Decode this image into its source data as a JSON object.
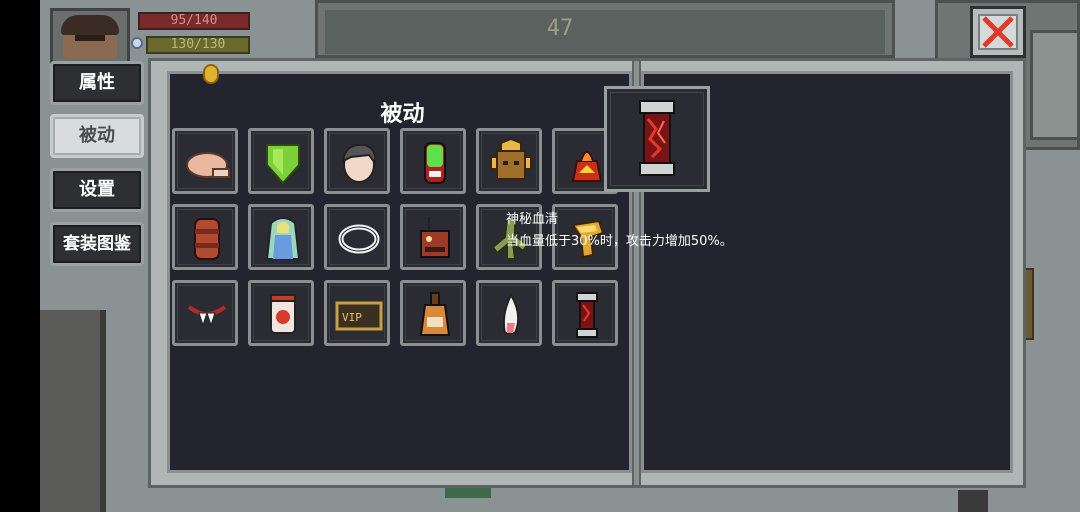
{
  "hud": {
    "hp_text": "95/140",
    "armor_text": "130/130",
    "wave_number": "47"
  },
  "tabs": [
    {
      "label": "属性",
      "active": false
    },
    {
      "label": "被动",
      "active": true
    },
    {
      "label": "设置",
      "active": false
    },
    {
      "label": "套装图鉴",
      "active": false
    }
  ],
  "panel": {
    "title": "被动"
  },
  "items": [
    {
      "icon": "roast-meat-icon"
    },
    {
      "icon": "green-shield-icon"
    },
    {
      "icon": "character-head-icon"
    },
    {
      "icon": "green-potion-icon"
    },
    {
      "icon": "golden-mask-icon"
    },
    {
      "icon": "fire-bag-icon"
    },
    {
      "icon": "leather-armor-icon"
    },
    {
      "icon": "rainbow-cloak-icon"
    },
    {
      "icon": "silver-bracelet-icon"
    },
    {
      "icon": "radio-device-icon"
    },
    {
      "icon": "tree-root-icon"
    },
    {
      "icon": "golden-horn-icon"
    },
    {
      "icon": "fang-necklace-icon"
    },
    {
      "icon": "red-jar-icon"
    },
    {
      "icon": "vip-card-icon"
    },
    {
      "icon": "whiskey-bottle-icon"
    },
    {
      "icon": "white-claw-icon"
    },
    {
      "icon": "blood-serum-icon"
    }
  ],
  "selected": {
    "icon": "blood-serum-icon",
    "name": "神秘血清",
    "description": "当血量低于30%时，攻击力增加50%。"
  },
  "colors": {
    "panel_bg": "#24242e",
    "frame": "#b0b6b6",
    "tab_active": "#d9dcdc",
    "close_x": "#e03a2a"
  }
}
